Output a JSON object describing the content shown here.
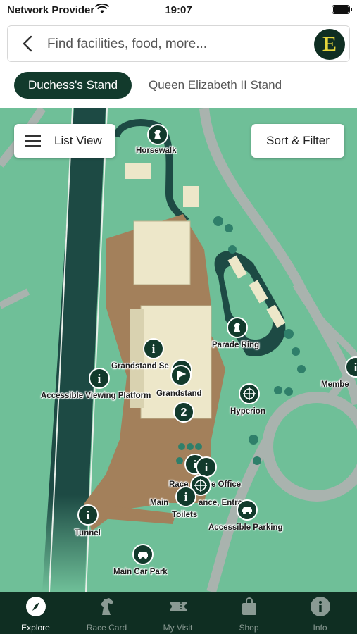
{
  "status_bar": {
    "carrier": "Network Provider",
    "time": "19:07"
  },
  "search": {
    "placeholder": "Find facilities, food, more...",
    "logo_letter": "E"
  },
  "stand_tabs": [
    {
      "label": "Duchess's Stand",
      "active": true
    },
    {
      "label": "Queen Elizabeth II Stand",
      "active": false
    }
  ],
  "map": {
    "list_view_label": "List View",
    "sort_filter_label": "Sort & Filter",
    "pins": [
      {
        "label": "Horsewalk",
        "icon": "horse-icon"
      },
      {
        "label": "Parade Ring",
        "icon": "horse-icon"
      },
      {
        "label": "Grandstand Se",
        "icon": "info-icon"
      },
      {
        "label": "Accessible Viewing Platform",
        "icon": "info-icon"
      },
      {
        "label": "Grandstand",
        "icon": "flag-icon"
      },
      {
        "label": "Hyperion",
        "icon": "crosshair-icon"
      },
      {
        "label": "Membe",
        "icon": "info-icon"
      },
      {
        "label": "Race",
        "icon": "info-icon"
      },
      {
        "label": "e Office",
        "icon": "info-icon"
      },
      {
        "label": "Main",
        "icon": "info-icon"
      },
      {
        "label": "ance, Entra",
        "icon": "crosshair-icon"
      },
      {
        "label": "Toilets",
        "icon": "info-icon"
      },
      {
        "label": "Accessible Parking",
        "icon": "car-icon"
      },
      {
        "label": "Tunnel",
        "icon": "info-icon"
      },
      {
        "label": "Main Car Park",
        "icon": "car-icon"
      }
    ],
    "cluster_count": "2",
    "cluster_count_2": "2"
  },
  "tab_bar": [
    {
      "label": "Explore",
      "icon": "compass-icon",
      "active": true
    },
    {
      "label": "Race Card",
      "icon": "horse-head-icon",
      "active": false
    },
    {
      "label": "My Visit",
      "icon": "ticket-icon",
      "active": false
    },
    {
      "label": "Shop",
      "icon": "bag-icon",
      "active": false
    },
    {
      "label": "Info",
      "icon": "info-icon",
      "active": false
    }
  ]
}
